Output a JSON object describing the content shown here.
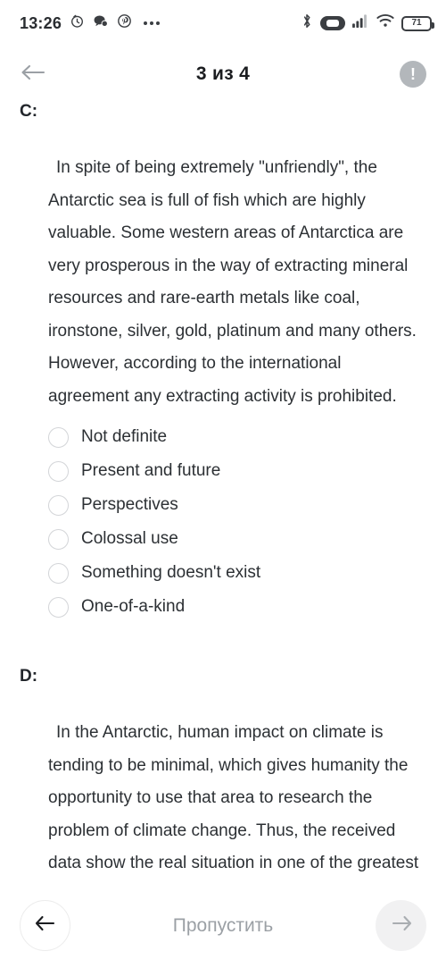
{
  "statusbar": {
    "time": "13:26",
    "left_icons": [
      "alarm-clock-icon",
      "messaging-icon",
      "pinterest-icon",
      "more-dots-icon"
    ],
    "right_icons": [
      "bluetooth-icon",
      "earbuds-battery-icon",
      "cellular-signal-icon",
      "wifi-icon"
    ],
    "battery_percent": "71"
  },
  "header": {
    "back_icon": "arrow-left-icon",
    "title": "3 из 4",
    "info_icon": "exclamation-circle-icon",
    "info_glyph": "!"
  },
  "content": {
    "sections": [
      {
        "label": "C:",
        "passage": "In spite of being extremely \"unfriendly\", the Antarctic sea is full of fish which are highly valuable. Some western areas of Antarctica are very prosperous in the way of extracting mineral resources and rare-earth metals like coal, ironstone, silver, gold, platinum and many others. However, according to the international agreement any extracting activity is prohibited.",
        "options": [
          "Not definite",
          "Present and future",
          "Perspectives",
          "Colossal use",
          "Something doesn't exist",
          "One-of-a-kind"
        ]
      },
      {
        "label": "D:",
        "passage": "In the Antarctic, human impact on climate is tending to be minimal, which gives humanity the opportunity to use that area to research the problem of climate change. Thus, the received data show the real situation in one of the greatest and unsolved problems without..."
      }
    ]
  },
  "progress": {
    "percent": 75,
    "fill_color": "#29a8e0",
    "track_color": "#dcdcdc"
  },
  "bottombar": {
    "prev_icon": "arrow-left-icon",
    "skip_label": "Пропустить",
    "next_icon": "arrow-right-icon"
  }
}
